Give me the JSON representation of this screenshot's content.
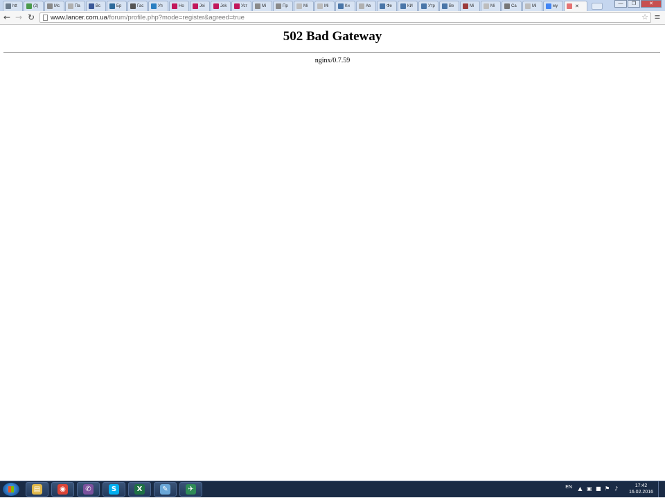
{
  "browser": {
    "tabs": [
      {
        "label": "htt",
        "icon": "chrome-icon",
        "color": "#6b7b8c"
      },
      {
        "label": "(2)",
        "icon": "whatsapp-icon",
        "color": "#4b9a4b"
      },
      {
        "label": "Мс",
        "icon": "olx-icon",
        "color": "#8a8a8a"
      },
      {
        "label": "Па",
        "icon": "page-icon",
        "color": "#b0b0b0"
      },
      {
        "label": "Вс",
        "icon": "facebook-icon",
        "color": "#3b5998"
      },
      {
        "label": "Бр",
        "icon": "chat-icon",
        "color": "#2d6a9a"
      },
      {
        "label": "Гас",
        "icon": "chat-icon",
        "color": "#555555"
      },
      {
        "label": "Уп",
        "icon": "triangle-icon",
        "color": "#2a7fc1"
      },
      {
        "label": "Но",
        "icon": "d-icon",
        "color": "#c2185b"
      },
      {
        "label": "Jei",
        "icon": "d-icon",
        "color": "#c2185b"
      },
      {
        "label": "Jek",
        "icon": "d-icon",
        "color": "#c2185b"
      },
      {
        "label": "Уст",
        "icon": "d-icon",
        "color": "#c2185b"
      },
      {
        "label": "Мі",
        "icon": "olx-icon",
        "color": "#8a8a8a"
      },
      {
        "label": "Пр",
        "icon": "olx-icon",
        "color": "#8a8a8a"
      },
      {
        "label": "Мі",
        "icon": "loader-icon",
        "color": "#bdbdbd"
      },
      {
        "label": "Мі",
        "icon": "loader-icon",
        "color": "#bdbdbd"
      },
      {
        "label": "Кн",
        "icon": "vk-icon",
        "color": "#4a76a8"
      },
      {
        "label": "Ав",
        "icon": "page-icon",
        "color": "#b0b0b0"
      },
      {
        "label": "Фе",
        "icon": "vk-icon",
        "color": "#4a76a8"
      },
      {
        "label": "КИ",
        "icon": "vk-icon",
        "color": "#4a76a8"
      },
      {
        "label": "Утр",
        "icon": "vk-icon",
        "color": "#4a76a8"
      },
      {
        "label": "Ве",
        "icon": "vk-icon",
        "color": "#4a76a8"
      },
      {
        "label": "Мі",
        "icon": "globe-icon",
        "color": "#9c3b3b"
      },
      {
        "label": "Мі",
        "icon": "loader-icon",
        "color": "#bdbdbd"
      },
      {
        "label": "Са",
        "icon": "gear-icon",
        "color": "#777777"
      },
      {
        "label": "Мі",
        "icon": "loader-icon",
        "color": "#bdbdbd"
      },
      {
        "label": "му",
        "icon": "google-icon",
        "color": "#4285f4"
      },
      {
        "label": "",
        "icon": "loader-icon",
        "color": "#e57373",
        "active": true
      }
    ],
    "close_tab_glyph": "✕",
    "window_controls": {
      "minimize": "—",
      "maximize": "❐",
      "close": "✕"
    },
    "nav": {
      "back": "←",
      "forward": "→",
      "reload": "↻",
      "menu": "≡",
      "star": "☆"
    },
    "url_host": "www.lancer.com.ua",
    "url_path": "/forum/profile.php?mode=register&agreed=true"
  },
  "page": {
    "heading": "502 Bad Gateway",
    "server": "nginx/0.7.59"
  },
  "taskbar": {
    "pinned": [
      {
        "name": "explorer-icon",
        "glyph": "▤",
        "color": "#e0b84a"
      },
      {
        "name": "chrome-icon",
        "glyph": "◉",
        "color": "#db4437"
      },
      {
        "name": "viber-icon",
        "glyph": "✆",
        "color": "#7b519d"
      },
      {
        "name": "skype-icon",
        "glyph": "S",
        "color": "#00aff0"
      },
      {
        "name": "excel-icon",
        "glyph": "X",
        "color": "#1e7145"
      },
      {
        "name": "notepad-icon",
        "glyph": "✎",
        "color": "#6aa7d8"
      },
      {
        "name": "app-icon",
        "glyph": "✈",
        "color": "#2e8b57"
      }
    ],
    "language": "EN",
    "time": "17:42",
    "date": "16.02.2016"
  }
}
